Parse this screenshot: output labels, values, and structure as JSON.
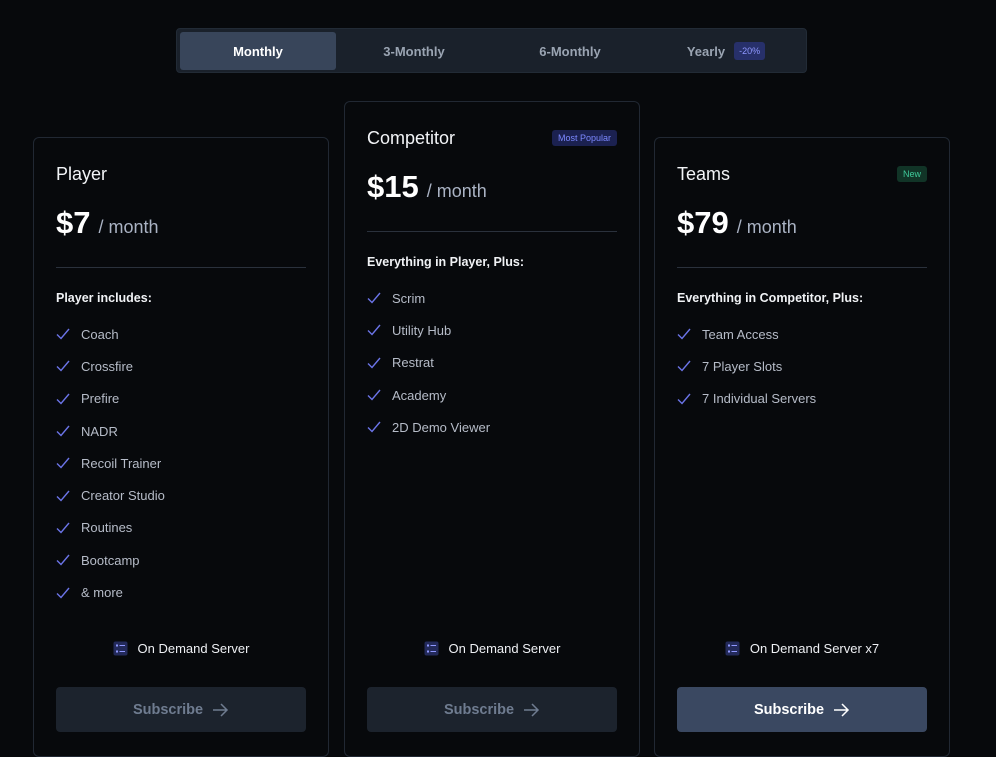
{
  "periods": [
    {
      "label": "Monthly",
      "active": true
    },
    {
      "label": "3-Monthly",
      "active": false
    },
    {
      "label": "6-Monthly",
      "active": false
    },
    {
      "label": "Yearly",
      "active": false,
      "badge": "-20%"
    }
  ],
  "plans": [
    {
      "name": "Player",
      "price": "$7",
      "period": "/ month",
      "features_heading": "Player includes:",
      "features": [
        "Coach",
        "Crossfire",
        "Prefire",
        "NADR",
        "Recoil Trainer",
        "Creator Studio",
        "Routines",
        "Bootcamp",
        "& more"
      ],
      "server": "On Demand Server",
      "subscribe_label": "Subscribe"
    },
    {
      "name": "Competitor",
      "badge": "Most Popular",
      "price": "$15",
      "period": "/ month",
      "features_heading": "Everything in Player, Plus:",
      "features": [
        "Scrim",
        "Utility Hub",
        "Restrat",
        "Academy",
        "2D Demo Viewer"
      ],
      "server": "On Demand Server",
      "subscribe_label": "Subscribe"
    },
    {
      "name": "Teams",
      "badge": "New",
      "price": "$79",
      "period": "/ month",
      "features_heading": "Everything in Competitor, Plus:",
      "features": [
        "Team Access",
        "7 Player Slots",
        "7 Individual Servers"
      ],
      "server": "On Demand Server x7",
      "subscribe_label": "Subscribe"
    }
  ],
  "icons": {
    "check": "check-icon",
    "server": "server-icon",
    "arrow": "arrow-right-icon"
  },
  "colors": {
    "accent": "#6b74e8",
    "popular_badge": "#7c88ff",
    "new_badge": "#3fc99a",
    "primary_button": "#3a4861"
  }
}
